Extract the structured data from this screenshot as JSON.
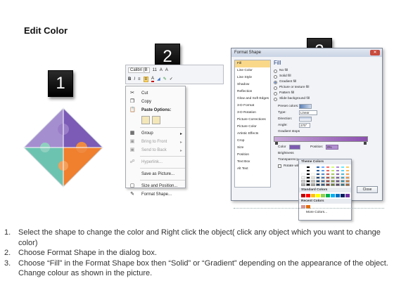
{
  "title": "Edit Color",
  "steps": {
    "s1": "1",
    "s2": "2",
    "s3": "3"
  },
  "mini_toolbar": {
    "font": "Calibri (B",
    "size": "11",
    "bold": "B",
    "italic": "I",
    "align": "≡"
  },
  "context_menu": {
    "cut": "Cut",
    "copy": "Copy",
    "paste_options": "Paste Options:",
    "group": "Group",
    "bring_to_front": "Bring to Front",
    "send_to_back": "Send to Back",
    "hyperlink": "Hyperlink...",
    "save_as_picture": "Save as Picture...",
    "size_and_position": "Size and Position...",
    "format_shape": "Format Shape..."
  },
  "dialog": {
    "title": "Format Shape",
    "close_label": "Close",
    "nav": [
      "Fill",
      "Line Color",
      "Line Style",
      "Shadow",
      "Reflection",
      "Glow and Soft Edges",
      "3-D Format",
      "3-D Rotation",
      "Picture Corrections",
      "Picture Color",
      "Artistic Effects",
      "Crop",
      "Size",
      "Position",
      "Text Box",
      "Alt Text"
    ],
    "fill_heading": "Fill",
    "options": [
      "No fill",
      "Solid fill",
      "Gradient fill",
      "Picture or texture fill",
      "Pattern fill",
      "Slide background fill"
    ],
    "preset_colors": "Preset colors:",
    "type_label": "Type:",
    "type_value": "Linear",
    "direction_label": "Direction:",
    "angle_label": "Angle:",
    "angle_value": "270°",
    "gradient_stops": "Gradient stops",
    "color_label": "Color",
    "position_label": "Position:",
    "position_value": "0%",
    "brightness_label": "Brightness",
    "transparency_label": "Transparency",
    "rotate_label": "Rotate with shape"
  },
  "color_popup": {
    "theme_colors": "Theme Colors",
    "standard_colors": "Standard Colors",
    "recent_colors": "Recent Colors",
    "more_colors": "More Colors..."
  },
  "instructions": [
    {
      "num": "1.",
      "text": "Select the shape to change the color and Right click the object( click any object which you want to change color)"
    },
    {
      "num": "2.",
      "text": "Choose Format Shape in the dialog box."
    },
    {
      "num": "3.",
      "text": "Choose “Fill” in the Format Shape box then “Solid” or “Gradient” depending on the appearance of the object. Change colour as shown in the picture."
    }
  ],
  "colors": {
    "purple": "#8e6bbf",
    "teal": "#4fb0a6",
    "orange": "#f07f2e",
    "green": "#7cc272",
    "lilac": "#b8a0d8"
  }
}
